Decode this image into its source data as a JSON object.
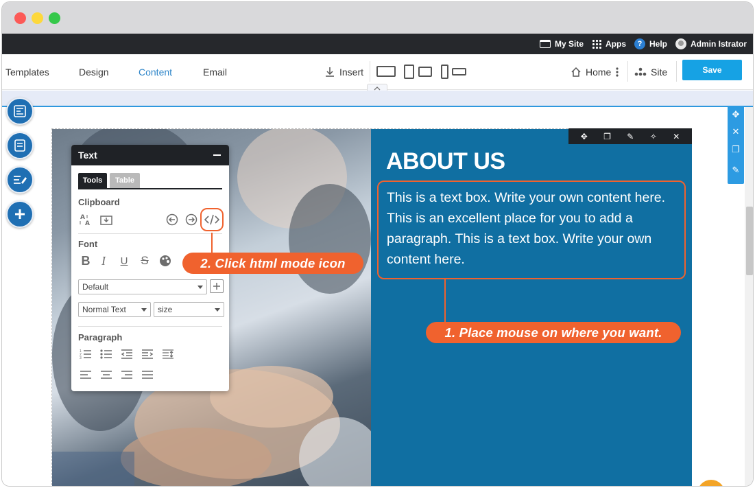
{
  "admin_bar": {
    "my_site": "My Site",
    "apps": "Apps",
    "help": "Help",
    "help_glyph": "?",
    "user": "Admin Istrator"
  },
  "toolbar": {
    "nav": [
      "Templates",
      "Design",
      "Content",
      "Email"
    ],
    "active_nav": "Content",
    "insert": "Insert",
    "home": "Home",
    "site": "Site",
    "save": "Save"
  },
  "section": {
    "title": "ABOUT US",
    "body": "This is a text box. Write your own content here. This is an excellent place for you to add a paragraph. This is a text box. Write your own content here."
  },
  "text_panel": {
    "title": "Text",
    "tabs": [
      "Tools",
      "Table"
    ],
    "clipboard": "Clipboard",
    "font": "Font",
    "font_select": "Default",
    "style_select": "Normal Text",
    "size_select": "size",
    "paragraph": "Paragraph",
    "bold": "B",
    "italic": "I",
    "underline": "U",
    "strike": "S"
  },
  "callouts": {
    "step1": "1. Place mouse on where you want.",
    "step2": "2. Click html mode icon"
  },
  "colors": {
    "accent": "#f0622e",
    "section_blue": "#106fa2",
    "save_blue": "#16a2e4",
    "admin_bar": "#26282c",
    "active_tab": "#2f86c9"
  }
}
